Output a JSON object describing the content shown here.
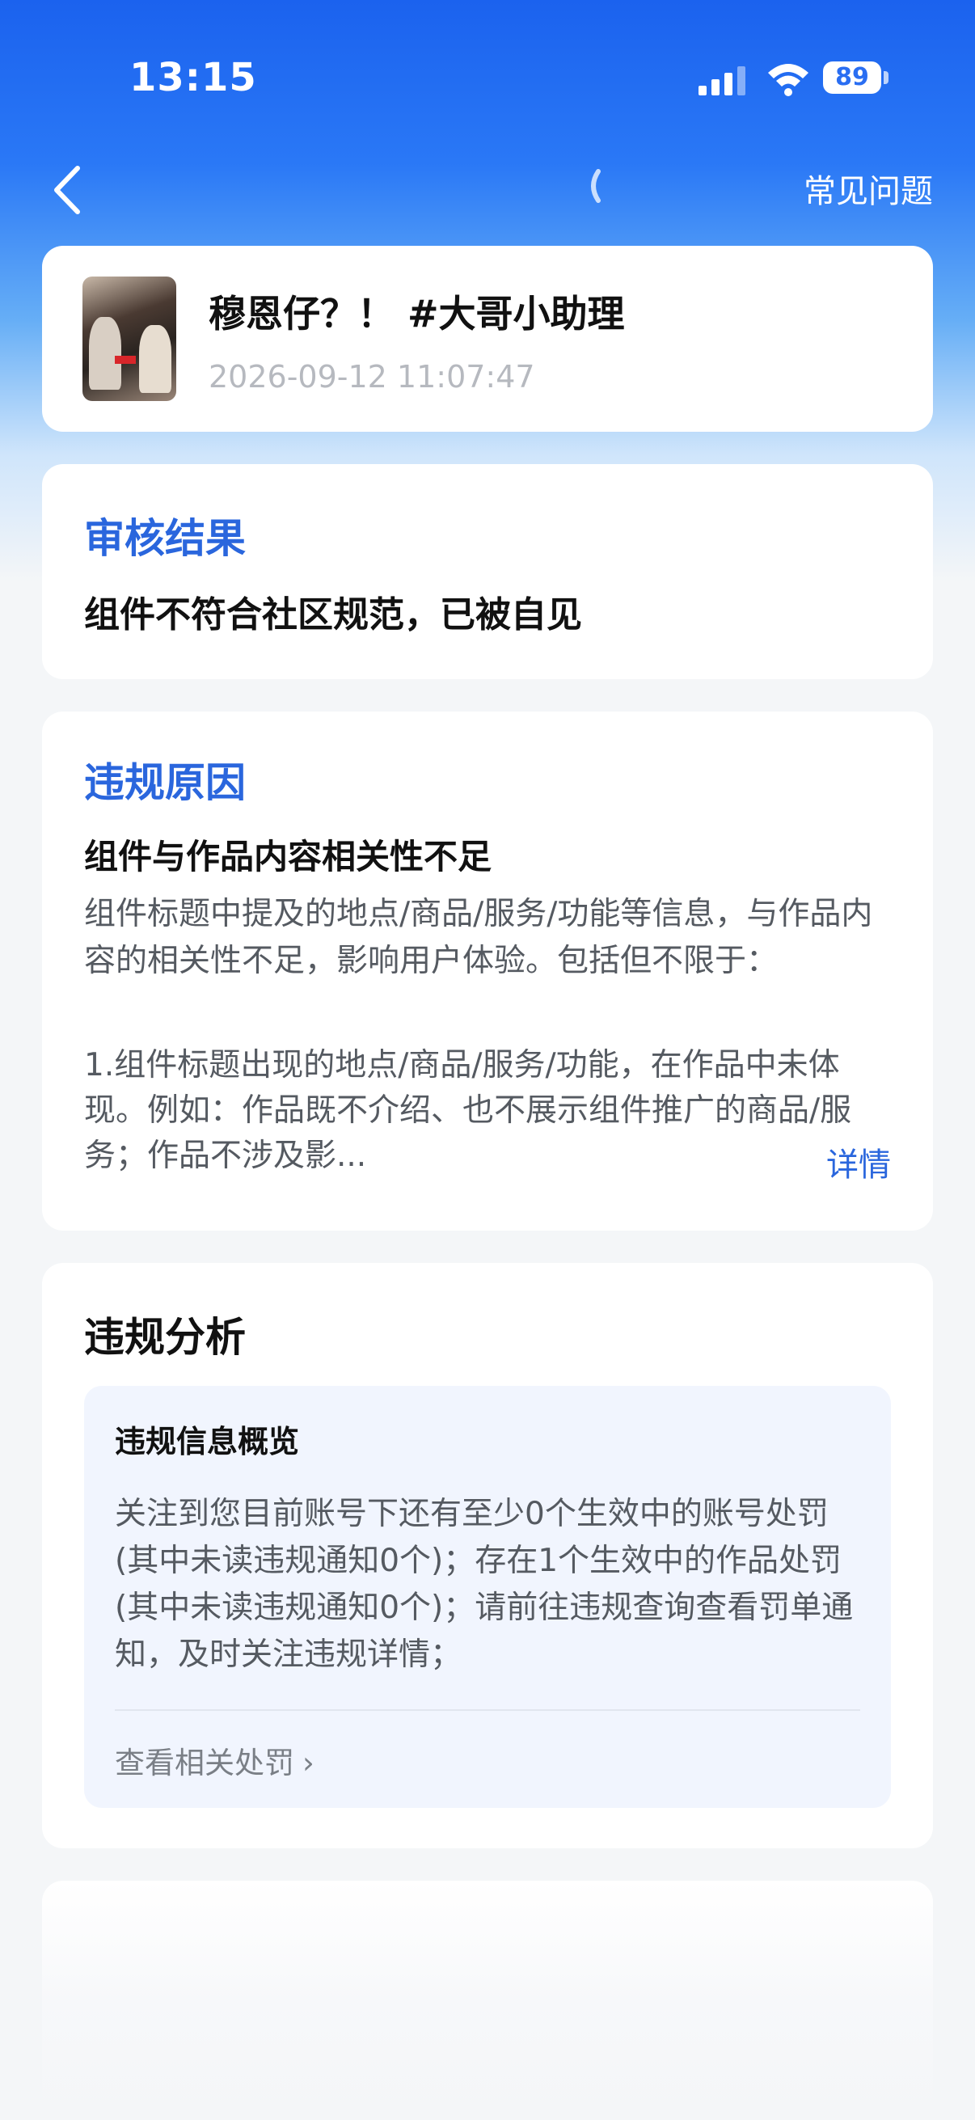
{
  "status_bar": {
    "time": "13:15",
    "battery": "89",
    "icons": [
      "signal-icon",
      "wifi-icon",
      "battery-icon"
    ]
  },
  "nav": {
    "back_icon": "back-chevron-icon",
    "faq_label": "常见问题"
  },
  "video": {
    "title": "穆恩仔？！ #大哥小助理",
    "timestamp": "2026-09-12 11:07:47"
  },
  "review_result": {
    "title": "审核结果",
    "text": "组件不符合社区规范，已被自见"
  },
  "violation_reason": {
    "title": "违规原因",
    "heading": "组件与作品内容相关性不足",
    "body": "组件标题中提及的地点/商品/服务/功能等信息，与作品内容的相关性不足，影响用户体验。包括但不限于：",
    "item": "1.组件标题出现的地点/商品/服务/功能，在作品中未体现。例如：作品既不介绍、也不展示组件推广的商品/服务；作品不涉及影...",
    "detail_link": "详情"
  },
  "violation_analysis": {
    "title": "违规分析",
    "overview_title": "违规信息概览",
    "overview_body": "关注到您目前账号下还有至少0个生效中的账号处罚(其中未读违规通知0个)；存在1个生效中的作品处罚(其中未读违规通知0个)；请前往违规查询查看罚单通知，及时关注违规详情；",
    "link_label": "查看相关处罚",
    "link_chevron": "›"
  },
  "colors": {
    "accent_blue": "#2a66dd",
    "header_blue": "#1b62ee",
    "overview_bg": "#f1f5fe"
  }
}
